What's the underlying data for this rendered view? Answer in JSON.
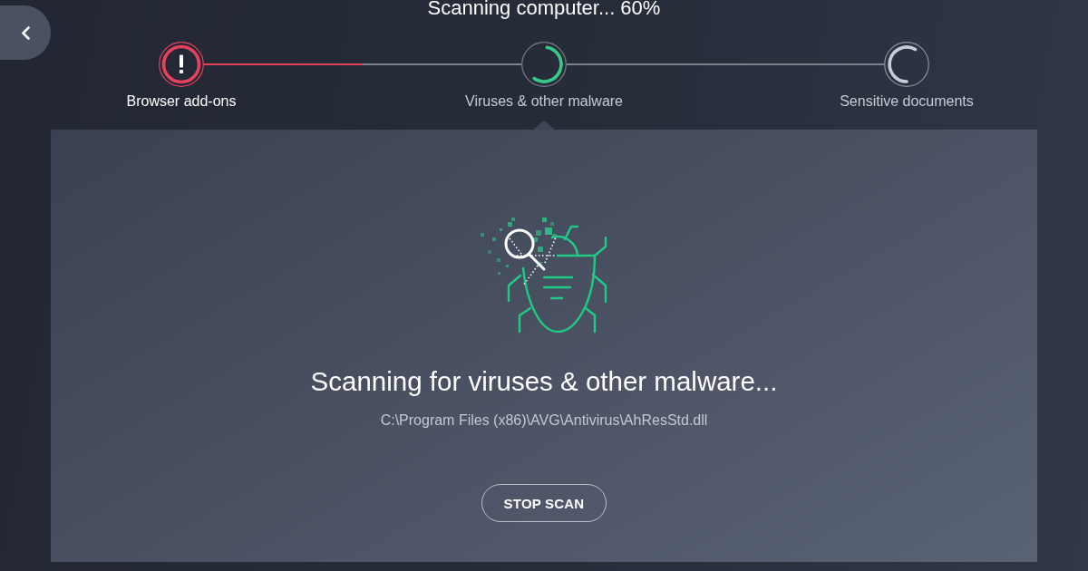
{
  "header": {
    "title": "Scanning computer... 60%"
  },
  "steps": [
    {
      "label": "Browser add-ons",
      "kind": "alert",
      "selected": false
    },
    {
      "label": "Viruses & other malware",
      "kind": "in_progress",
      "selected": true
    },
    {
      "label": "Sensitive documents",
      "kind": "pending",
      "selected": false
    }
  ],
  "connectors": [
    {
      "level": 0.5
    }
  ],
  "panel": {
    "heading": "Scanning for viruses & other malware...",
    "current_file": "C:\\Program Files (x86)\\AVG\\Antivirus\\AhResStd.dll",
    "button": "STOP SCAN"
  }
}
